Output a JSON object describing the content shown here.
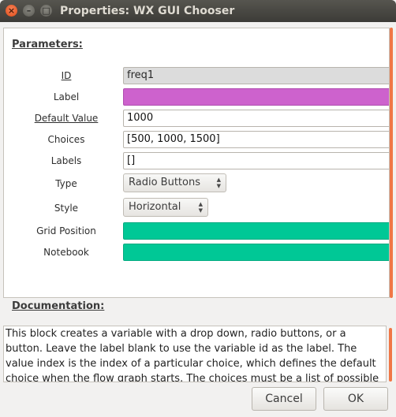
{
  "window": {
    "title": "Properties: WX GUI Chooser"
  },
  "parameters": {
    "heading": "Parameters:",
    "rows": [
      {
        "label": "ID",
        "value": "freq1"
      },
      {
        "label": "Label",
        "value": ""
      },
      {
        "label": "Default Value",
        "value": "1000"
      },
      {
        "label": "Choices",
        "value": "[500, 1000, 1500]"
      },
      {
        "label": "Labels",
        "value": "[]"
      },
      {
        "label": "Type",
        "value": "Radio Buttons"
      },
      {
        "label": "Style",
        "value": "Horizontal"
      },
      {
        "label": "Grid Position",
        "value": ""
      },
      {
        "label": "Notebook",
        "value": ""
      }
    ]
  },
  "documentation": {
    "heading": "Documentation:",
    "text": "This block creates a variable with a drop down, radio buttons, or a button. Leave the label blank to use the variable id as the label. The value index is the index of a particular choice, which defines the default choice when the flow graph starts. The choices must be a list of possible values. Leave labels empty to use the choices as the labels."
  },
  "buttons": {
    "cancel": "Cancel",
    "ok": "OK"
  },
  "colors": {
    "label_field": "#cd62cd",
    "position_field": "#00c896",
    "accent": "#f07746"
  }
}
